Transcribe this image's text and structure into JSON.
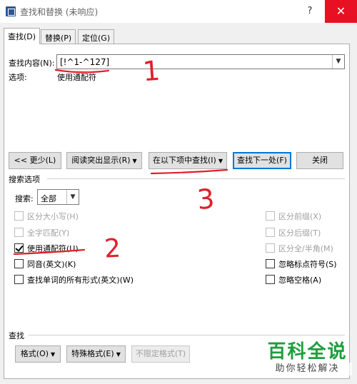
{
  "window": {
    "title": "查找和替换 (未响应)",
    "help": "?",
    "close": "✕"
  },
  "tabs": [
    {
      "label": "查找(D)",
      "active": true
    },
    {
      "label": "替换(P)",
      "active": false
    },
    {
      "label": "定位(G)",
      "active": false
    }
  ],
  "find": {
    "label": "查找内容(N):",
    "value": "[!^1-^127]",
    "options_label": "选项:",
    "options_value": "使用通配符"
  },
  "buttons": {
    "less": "<< 更少(L)",
    "reading_highlight": "阅读突出显示(R)",
    "find_in": "在以下项中查找(I)",
    "find_next": "查找下一处(F)",
    "close": "关闭"
  },
  "search_options": {
    "title": "搜索选项",
    "search_label": "搜索:",
    "search_value": "全部",
    "left": [
      {
        "label": "区分大小写(H)",
        "checked": false,
        "disabled": true
      },
      {
        "label": "全字匹配(Y)",
        "checked": false,
        "disabled": true
      },
      {
        "label": "使用通配符(U)",
        "checked": true,
        "disabled": false
      },
      {
        "label": "同音(英文)(K)",
        "checked": false,
        "disabled": false
      },
      {
        "label": "查找单词的所有形式(英文)(W)",
        "checked": false,
        "disabled": false
      }
    ],
    "right": [
      {
        "label": "区分前缀(X)",
        "checked": false,
        "disabled": true
      },
      {
        "label": "区分后缀(T)",
        "checked": false,
        "disabled": true
      },
      {
        "label": "区分全/半角(M)",
        "checked": false,
        "disabled": true
      },
      {
        "label": "忽略标点符号(S)",
        "checked": false,
        "disabled": false
      },
      {
        "label": "忽略空格(A)",
        "checked": false,
        "disabled": false
      }
    ]
  },
  "find_section": {
    "title": "查找",
    "format": "格式(O)",
    "special": "特殊格式(E)",
    "no_format": "不限定格式(T)"
  },
  "annotations": [
    "1",
    "2",
    "3"
  ],
  "watermark": {
    "brand": "百科全说",
    "slogan": "助你轻松解决"
  }
}
